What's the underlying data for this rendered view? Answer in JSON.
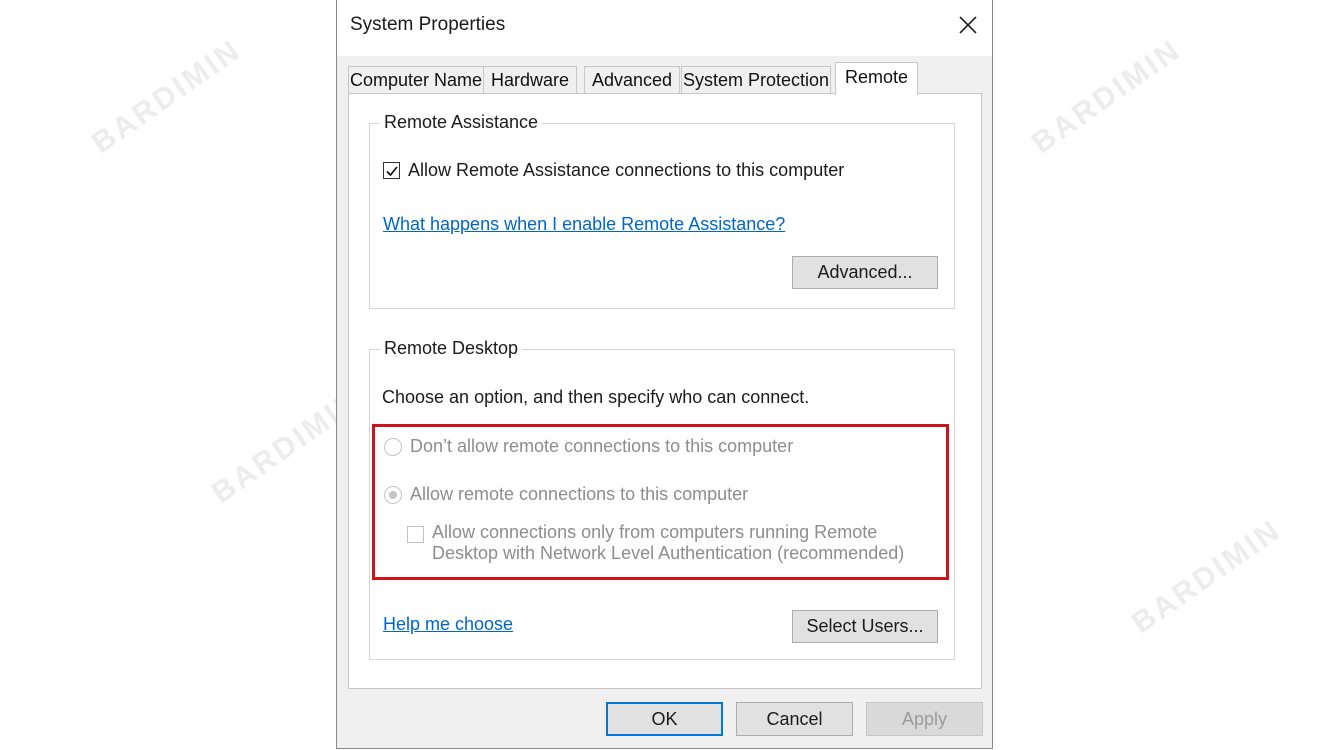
{
  "watermark": "BARDIMIN",
  "dialog": {
    "title": "System Properties",
    "close_icon": "close-icon"
  },
  "tabs": [
    {
      "label": "Computer Name",
      "active": false
    },
    {
      "label": "Hardware",
      "active": false
    },
    {
      "label": "Advanced",
      "active": false
    },
    {
      "label": "System Protection",
      "active": false
    },
    {
      "label": "Remote",
      "active": true
    }
  ],
  "remote_assistance": {
    "legend": "Remote Assistance",
    "allow_checkbox": {
      "label": "Allow Remote Assistance connections to this computer",
      "checked": true
    },
    "help_link": "What happens when I enable Remote Assistance?",
    "advanced_button": "Advanced..."
  },
  "remote_desktop": {
    "legend": "Remote Desktop",
    "instruction": "Choose an option, and then specify who can connect.",
    "option_dont_allow": {
      "label": "Don’t allow remote connections to this computer",
      "selected": false,
      "enabled": false
    },
    "option_allow": {
      "label": "Allow remote connections to this computer",
      "selected": true,
      "enabled": false
    },
    "nla_checkbox": {
      "line1": "Allow connections only from computers running Remote",
      "line2": "Desktop with Network Level Authentication (recommended)",
      "checked": false,
      "enabled": false
    },
    "help_link": "Help me choose",
    "select_users_button": "Select Users..."
  },
  "footer": {
    "ok": "OK",
    "cancel": "Cancel",
    "apply": "Apply"
  },
  "colors": {
    "link": "#0066cc",
    "highlight": "#d0121b",
    "primary_border": "#0078d7"
  }
}
